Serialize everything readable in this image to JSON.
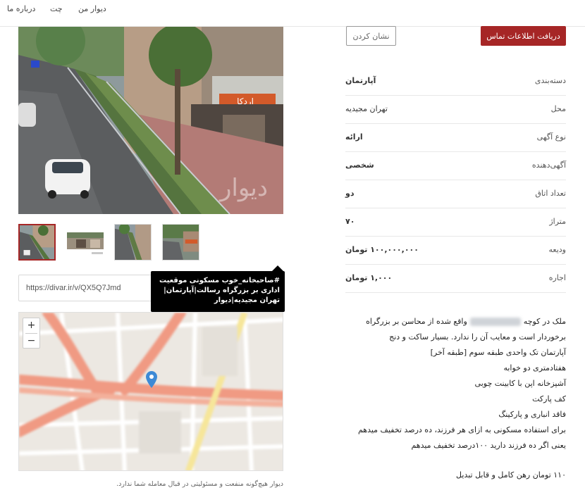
{
  "nav": {
    "about": "درباره ما",
    "chat": "چت",
    "my_divar": "دیوار من"
  },
  "actions": {
    "contact_label": "دریافت اطلاعات تماس",
    "show_label": "نشان کردن"
  },
  "details": [
    {
      "key": "دسته‌بندی",
      "value": "آپارتمان"
    },
    {
      "key": "محل",
      "value": "تهران مجیدیه"
    },
    {
      "key": "نوع آگهی",
      "value": "ارائه"
    },
    {
      "key": "آگهی‌دهنده",
      "value": "شخصی"
    },
    {
      "key": "تعداد اتاق",
      "value": "دو"
    },
    {
      "key": "متراژ",
      "value": "۷۰"
    },
    {
      "key": "ودیعه",
      "value": "۱۰۰,۰۰۰,۰۰۰ تومان"
    },
    {
      "key": "اجاره",
      "value": "۱,۰۰۰ تومان"
    }
  ],
  "description": {
    "line1_start": "ملک در کوچه",
    "line1_end": "واقع شده از محاسن بر بزرگراه",
    "lines": [
      "برخوردار است و معایب آن را ندارد. بسیار ساکت و دنج",
      "آپارتمان تک واحدی طبقه سوم [طبقه آخر]",
      "هفتادمتری دو خوابه",
      "آشپزخانه اپن با کابینت چوبی",
      "کف پارکت",
      "فاقد انباری و پارکینگ",
      "برای استفاده مسکونی به ازای هر فرزند، ده درصد تخفیف میدهم",
      "یعنی اگر ده فرزند دارید ۱۰۰درصد تخفیف میدهم"
    ],
    "last_line": "۱۱۰ تومان رهن کامل و قابل تبدیل"
  },
  "share": {
    "url": "https://divar.ir/v/QX5Q7Jmd",
    "tooltip": "#صاحبخانه_خوب مسکونی موقعیت اداری بر بزرگراه رسالت|آپارتمان|تهران مجیدیه|دیوار"
  },
  "map": {
    "zoom_in": "+",
    "zoom_out": "−"
  },
  "disclaimer": "دیوار هیچ‌گونه منفعت و مسئولیتی در قبال معامله شما ندارد.",
  "photo": {
    "watermark": "دیوار",
    "sign": "اردکا"
  },
  "colors": {
    "accent": "#a62626"
  }
}
